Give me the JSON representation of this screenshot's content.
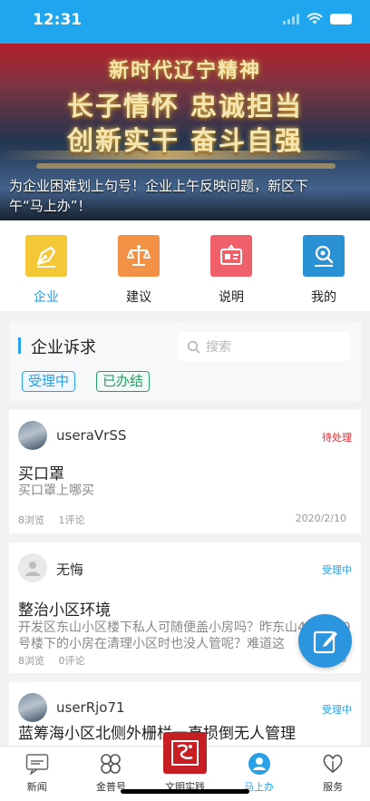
{
  "status_bar": {
    "time": "12:31"
  },
  "banner": {
    "slogan_line1": "新时代辽宁精神",
    "slogan_line2": "长子情怀 忠诚担当",
    "slogan_line3": "创新实干 奋斗自强",
    "caption": "为企业困难划上句号！企业上午反映问题，新区下午“马上办”！",
    "page_count": 3,
    "active_page": 1
  },
  "quick_nav": [
    {
      "label": "企业",
      "icon": "pen-nib-icon",
      "color": "#f4c736",
      "active": true
    },
    {
      "label": "建议",
      "icon": "scales-icon",
      "color": "#f39246",
      "active": false
    },
    {
      "label": "说明",
      "icon": "id-card-icon",
      "color": "#f0606a",
      "active": false
    },
    {
      "label": "我的",
      "icon": "search-doc-icon",
      "color": "#2a92d4",
      "active": false
    }
  ],
  "panel": {
    "title": "企业诉求",
    "search_placeholder": "搜索",
    "filter_processing": "受理中",
    "filter_done": "已办结"
  },
  "feed": [
    {
      "username": "useraVrSS",
      "status": "待处理",
      "title": "买口罩",
      "desc": "买口罩上哪买",
      "views": "8浏览",
      "comments": "1评论",
      "date": "2020/2/10"
    },
    {
      "username": "无悔",
      "status": "受理中",
      "title": "整治小区环境",
      "desc": "开发区东山小区楼下私人可随便盖小房吗？昨东山46号100号楼下的小房在清理小区时也没人管呢？难道这",
      "views": "8浏览",
      "comments": "0评论",
      "date": "20"
    },
    {
      "username": "userRjo71",
      "status": "受理中",
      "title": "蓝筹海小区北侧外栅栏一直损倒无人管理"
    }
  ],
  "tabs": [
    {
      "label": "新闻",
      "icon": "news-icon"
    },
    {
      "label": "金普号",
      "icon": "clover-icon"
    },
    {
      "label": "文明实践",
      "icon": "seal-icon"
    },
    {
      "label": "马上办",
      "icon": "user-circle-icon",
      "active": true
    },
    {
      "label": "服务",
      "icon": "hands-heart-icon"
    }
  ],
  "colors": {
    "brand_blue": "#20a6ee",
    "pending_red": "#e0262f",
    "done_green": "#2a9b6b"
  }
}
